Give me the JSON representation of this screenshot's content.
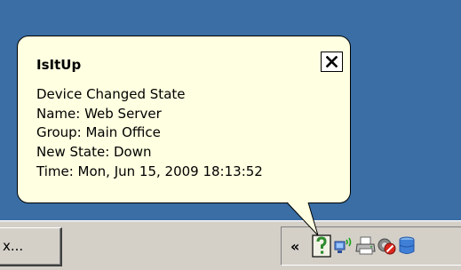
{
  "balloon": {
    "title": "IsItUp",
    "close_label": "✕",
    "lines": [
      "Device Changed State",
      "Name: Web Server",
      "Group: Main Office",
      "New State: Down",
      "Time: Mon, Jun 15, 2009 18:13:52"
    ]
  },
  "taskbar": {
    "task_button_label": "x...",
    "tray_chevron": "«",
    "tray_icons": [
      "isitup-question-icon",
      "network-wireless-icon",
      "printer-icon",
      "security-icon",
      "database-icon"
    ]
  },
  "colors": {
    "desktop": "#3a6ea5",
    "balloon_background": "#ffffe1",
    "taskbar": "#d4d0c8",
    "isitup_icon_green": "#2e8b2e"
  }
}
